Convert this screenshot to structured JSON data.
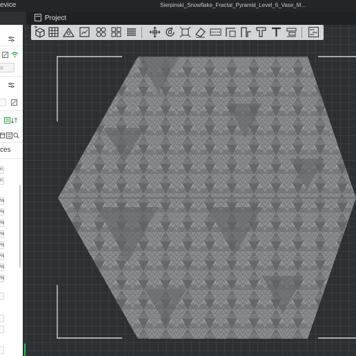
{
  "window": {
    "title": "Sierpinski_Snowflake_Fractal_Pyramid_Level_6_Vase_M..."
  },
  "tabs": {
    "device_label": "evice",
    "project_label": "Project"
  },
  "sidebar": {
    "placeholder_label": "e",
    "section_label": "ces",
    "field_values": [
      "n",
      "n"
    ],
    "percent_values": [
      "%",
      "%",
      "%",
      "%",
      "%",
      "%",
      "%",
      "%"
    ],
    "colors": {
      "panel": "#ffffff",
      "accent": "#1f9c3c"
    }
  },
  "toolbar": {
    "buttons": [
      "add-cube-icon",
      "grid-plate-icon",
      "auto-orient-icon",
      "arrange-icon",
      "split-objects-icon",
      "split-parts-icon",
      "layers-icon",
      "move-icon",
      "rotate-icon",
      "scale-icon",
      "erase-icon",
      "cut-icon",
      "seam-icon",
      "support-paint-icon",
      "measure-icon",
      "text-icon",
      "assembly-icon",
      "variable-layer-icon"
    ]
  },
  "model": {
    "shape": "hexagon",
    "pattern": "sierpinski-fractal",
    "fill": "#8c8e90",
    "dark": "#5e6163"
  }
}
